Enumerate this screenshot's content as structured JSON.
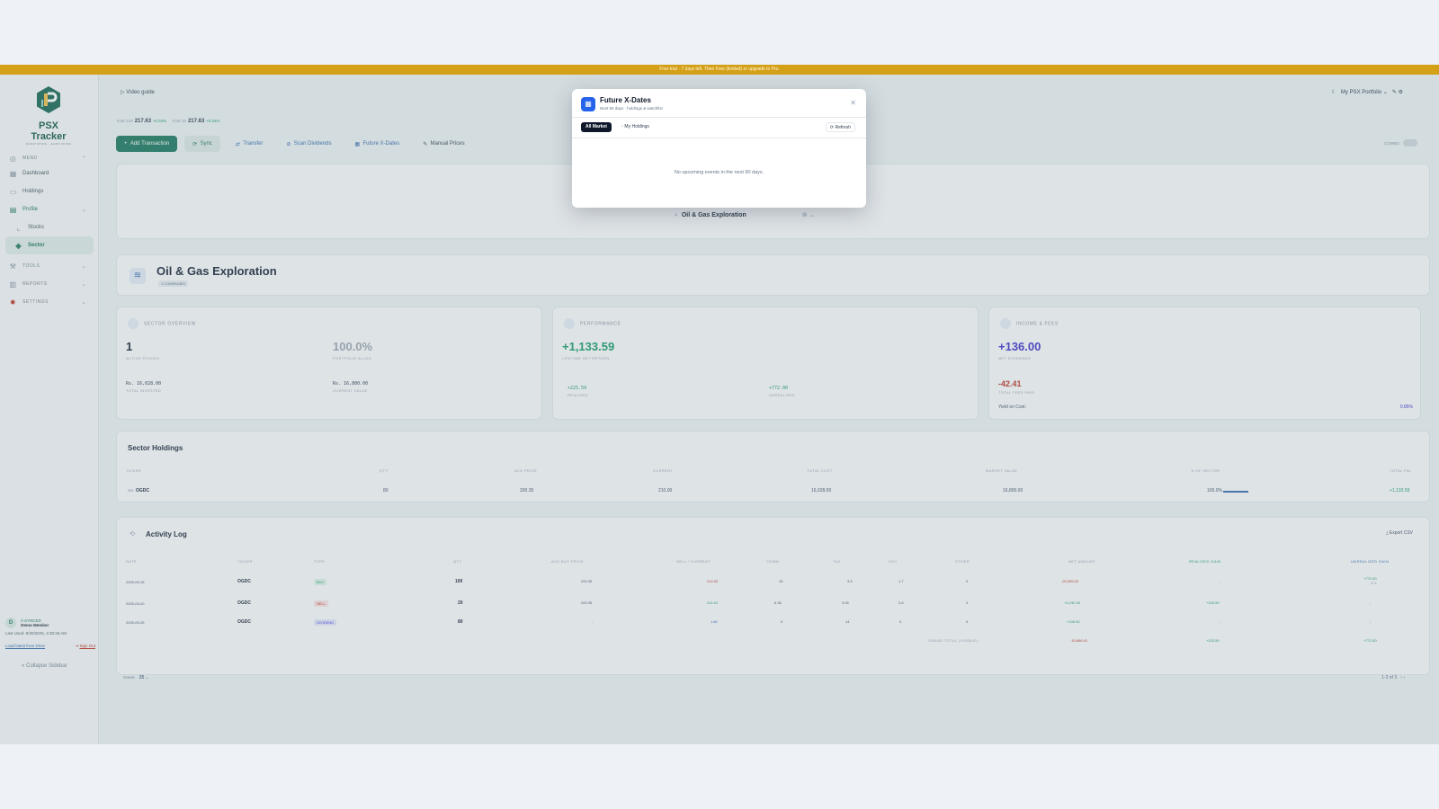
{
  "banner": {
    "text": "Free trial · 7 days left. Then Free (limited) or upgrade to Pro."
  },
  "brand": {
    "name": "PSX Tracker",
    "tagline": "KNOW MORE · EARN MORE"
  },
  "nav": {
    "menu_label": "MENU",
    "items": [
      {
        "label": "Dashboard"
      },
      {
        "label": "Holdings"
      },
      {
        "label": "Profile"
      },
      {
        "label": "Stocks"
      },
      {
        "label": "Sector"
      }
    ],
    "tools_label": "TOOLS",
    "reports_label": "REPORTS",
    "settings_label": "SETTINGS"
  },
  "user": {
    "initial": "D",
    "badge": "0 SYNCED",
    "name": "Demo Member",
    "last_used": "Last Used: 8/30/2025, 2:30:26 AM",
    "load_label": "Load latest from Drive",
    "signout_label": "Sign Out"
  },
  "collapse_label": "Collapse Sidebar",
  "topbar": {
    "video_guide": "Video guide",
    "portfolio": "My PSX Portfolio"
  },
  "tickers": [
    {
      "label": "KSE-100",
      "value": "217.63",
      "change": "+0.34%"
    },
    {
      "label": "KSE-30",
      "value": "217.63",
      "change": "+0.34%"
    }
  ],
  "toolbar": {
    "add": "Add Transaction",
    "sync": "Sync",
    "transfer": "Transfer",
    "scan": "Scan Dividends",
    "xdates": "Future X-Dates",
    "manual": "Manual Prices",
    "combo": "COMBO"
  },
  "filter": {
    "selected_sector": "Oil & Gas Exploration"
  },
  "sector": {
    "title": "Oil & Gas Exploration",
    "badge": "1 COMPANIES"
  },
  "overview": {
    "heading": "SECTOR OVERVIEW",
    "active_value": "1",
    "active_label": "ACTIVE STOCKS",
    "alloc_value": "100.0%",
    "alloc_label": "PORTFOLIO ALLOC.",
    "invested_value": "Rs. 16,028.00",
    "invested_label": "TOTAL INVESTED",
    "current_value": "Rs. 16,800.00",
    "current_label": "CURRENT VALUE"
  },
  "performance": {
    "heading": "PERFORMANCE",
    "lifetime_value": "+1,133.59",
    "lifetime_label": "LIFETIME NET RETURN",
    "realized_value": "+225.59",
    "realized_label": "REALIZED",
    "unrealized_value": "+772.00",
    "unrealized_label": "UNREALIZED"
  },
  "income": {
    "heading": "INCOME & FEES",
    "div_value": "+136.00",
    "div_label": "NET DIVIDENDS",
    "fees_value": "-42.41",
    "fees_label": "TOTAL FEES PAID",
    "yield_label": "Yield on Cost:",
    "yield_value": "0.85%"
  },
  "holdings": {
    "title": "Sector Holdings",
    "columns": [
      "TICKER",
      "QTY",
      "AVG PRICE",
      "CURRENT",
      "TOTAL COST",
      "MARKET VALUE",
      "% OF SECTOR",
      "TOTAL P&L"
    ],
    "rows": [
      {
        "ticker": "OGDC",
        "qty": "80",
        "avg": "200.35",
        "current": "210.00",
        "cost": "16,028.00",
        "market": "16,800.00",
        "pct": "100.0%",
        "pnl": "+1,133.59"
      }
    ]
  },
  "activity": {
    "title": "Activity Log",
    "export": "Export CSV",
    "columns": [
      "DATE",
      "TICKER",
      "TYPE",
      "QTY",
      "AVG BUY PRICE",
      "SELL / CURRENT",
      "COMM",
      "TAX",
      "CDC",
      "OTHER",
      "NET AMOUNT",
      "REALIZED GAIN",
      "UNREALIZED GAIN"
    ],
    "rows": [
      {
        "date": "2025-09-15",
        "ticker": "OGDC",
        "type": "BUY",
        "qty": "100",
        "avg": "200.35",
        "sell": "210.00",
        "comm": "15",
        "tax": "3.5",
        "cdc": "1.7",
        "other": "0",
        "net": "-20,055.00",
        "realized": "-",
        "unrealized": "+772.00",
        "unrealized_sub": "-0.4"
      },
      {
        "date": "2025-09-20",
        "ticker": "OGDC",
        "type": "SELL",
        "qty": "20",
        "avg": "200.35",
        "sell": "211.63",
        "comm": "6.36",
        "tax": "3.05",
        "cdc": "0.6",
        "other": "0",
        "net": "+4,232.55",
        "realized": "+225.59",
        "unrealized": "-",
        "unrealized_sub": ""
      },
      {
        "date": "2025-09-25",
        "ticker": "OGDC",
        "type": "DIVIDEND",
        "qty": "80",
        "avg": "-",
        "sell": "1.80",
        "comm": "0",
        "tax": "14",
        "cdc": "0",
        "other": "0",
        "net": "+136.00",
        "realized": "-",
        "unrealized": "-",
        "unrealized_sub": ""
      }
    ],
    "grand_label": "GRAND TOTAL (VISIBLE)",
    "grand_net": "-15,666.41",
    "grand_realized": "+225.59",
    "grand_unrealized": "+772.00",
    "rows_label": "ROWS:",
    "rows_value": "25",
    "pager": "1-3 of 3"
  },
  "modal": {
    "title": "Future X-Dates",
    "subtitle": "Next 90 days · holdings & watchlist",
    "tab_all": "All Market",
    "tab_holdings": "My Holdings",
    "refresh": "Refresh",
    "empty": "No upcoming events in the next 90 days."
  }
}
